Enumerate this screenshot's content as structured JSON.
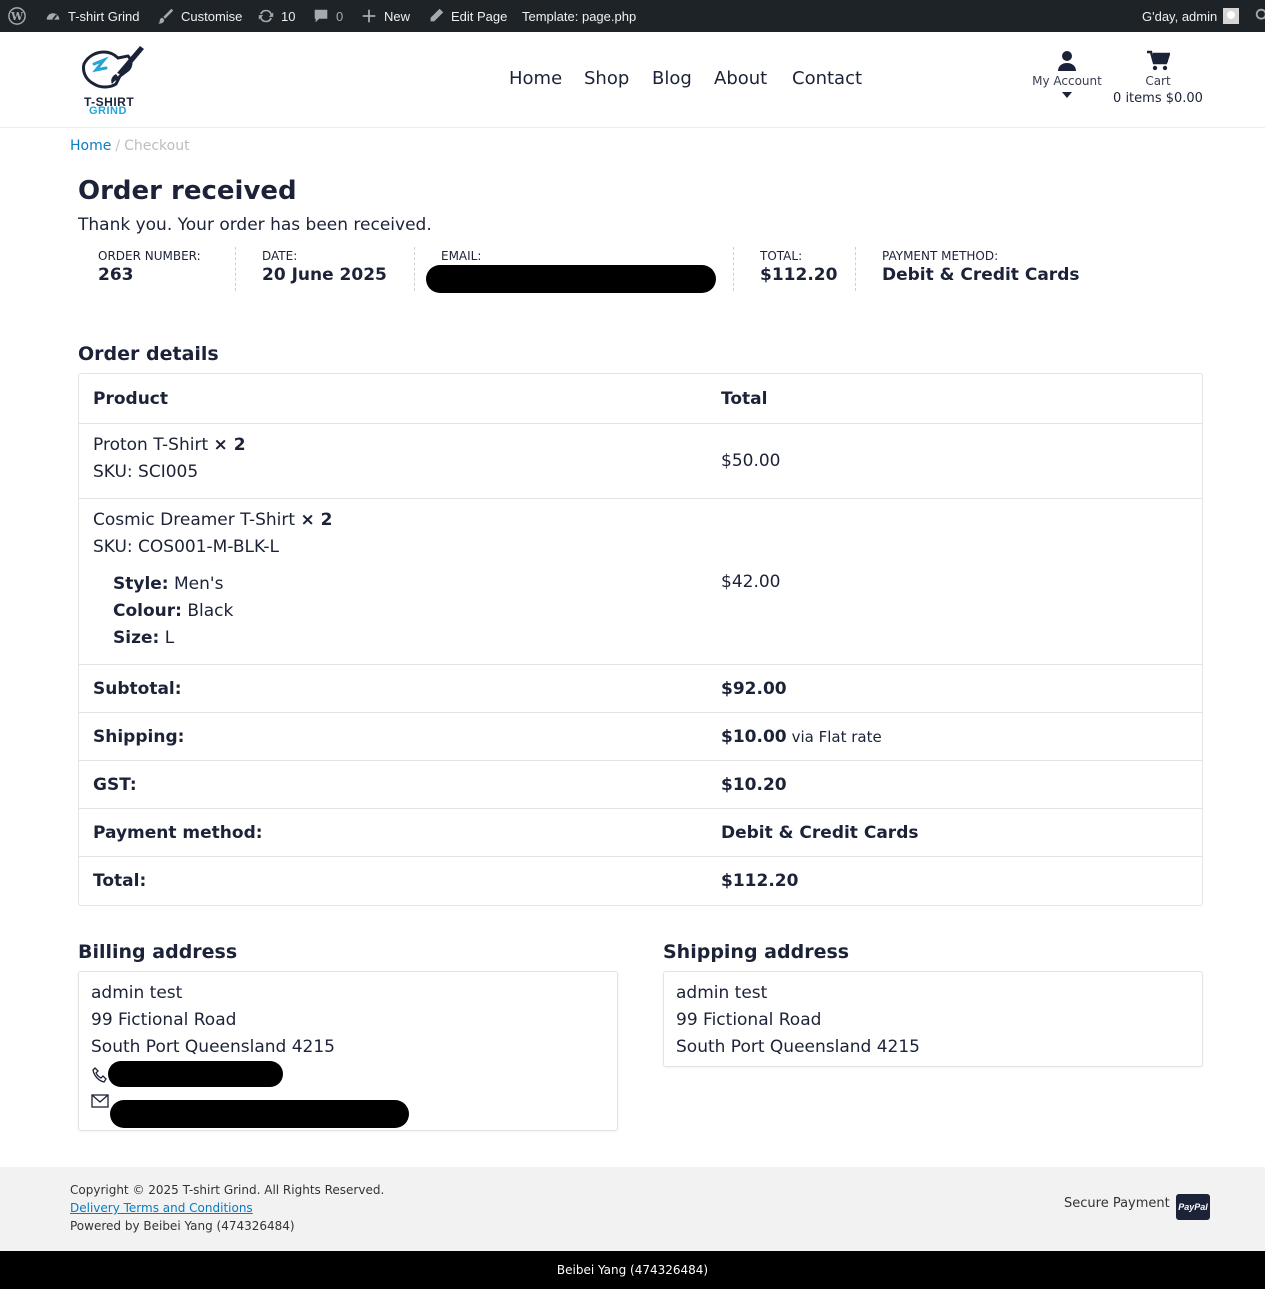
{
  "admin_bar": {
    "site_name": "T-shirt Grind",
    "customise": "Customise",
    "updates_count": "10",
    "comments_count": "0",
    "new": "New",
    "edit_page": "Edit Page",
    "template": "Template: page.php",
    "greeting": "G'day, admin"
  },
  "header": {
    "logo_line1": "T-SHIRT",
    "logo_line2": "GRIND",
    "nav": [
      "Home",
      "Shop",
      "Blog",
      "About",
      "Contact"
    ],
    "account_label": "My Account",
    "cart_label": "Cart",
    "cart_summary": "0 items $0.00"
  },
  "breadcrumb": {
    "home": "Home",
    "separator": "/",
    "current": "Checkout"
  },
  "page": {
    "title": "Order received",
    "thanks": "Thank you. Your order has been received."
  },
  "overview": {
    "order_number_label": "Order number:",
    "order_number": "263",
    "date_label": "Date:",
    "date": "20 June 2025",
    "email_label": "Email:",
    "total_label": "Total:",
    "total": "$112.20",
    "payment_label": "Payment method:",
    "payment": "Debit & Credit Cards"
  },
  "order_details": {
    "heading": "Order details",
    "col_product": "Product",
    "col_total": "Total",
    "items": [
      {
        "name": "Proton T-Shirt",
        "qty": "× 2",
        "sku": "SKU: SCI005",
        "total": "$50.00"
      },
      {
        "name": "Cosmic Dreamer T-Shirt",
        "qty": "× 2",
        "sku": "SKU: COS001-M-BLK-L",
        "style_label": "Style:",
        "style": "Men's",
        "colour_label": "Colour:",
        "colour": "Black",
        "size_label": "Size:",
        "size": "L",
        "total": "$42.00"
      }
    ],
    "subtotal_label": "Subtotal:",
    "subtotal": "$92.00",
    "shipping_label": "Shipping:",
    "shipping": "$10.00",
    "shipping_via": "via Flat rate",
    "gst_label": "GST:",
    "gst": "$10.20",
    "payment_label": "Payment method:",
    "payment": "Debit & Credit Cards",
    "total_label": "Total:",
    "total": "$112.20"
  },
  "billing": {
    "heading": "Billing address",
    "name": "admin test",
    "street": "99 Fictional Road",
    "city": "South Port Queensland 4215"
  },
  "shipping": {
    "heading": "Shipping address",
    "name": "admin test",
    "street": "99 Fictional Road",
    "city": "South Port Queensland 4215"
  },
  "footer": {
    "copyright": "Copyright © 2025 T-shirt Grind. All Rights Reserved.",
    "delivery_link": "Delivery Terms and Conditions",
    "powered_by": "Powered by Beibei Yang (474326484)",
    "secure_payment": "Secure Payment",
    "paypal_badge": "PayPal",
    "bottom_bar": "Beibei Yang (474326484)"
  },
  "colors": {
    "admin_bar_bg": "#1d2327",
    "text_primary": "#1c2237",
    "link": "#0a7bc0",
    "logo_accent": "#26a3d9",
    "footer_bg": "#f2f2f2"
  }
}
